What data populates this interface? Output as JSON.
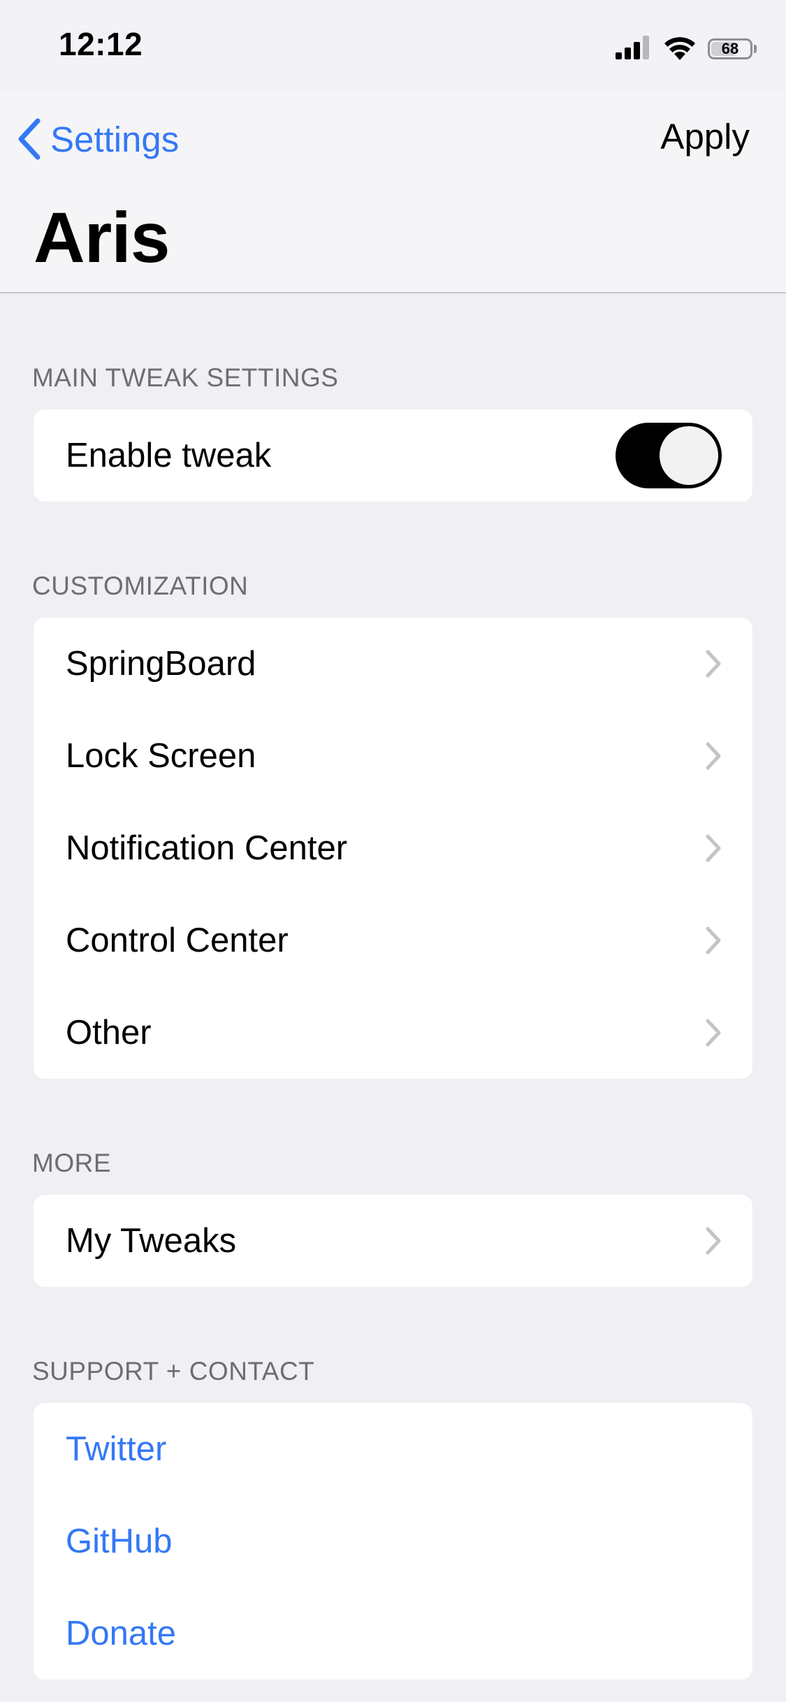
{
  "status_bar": {
    "time": "12:12",
    "battery": "68",
    "icons": [
      "cellular-signal-icon",
      "wifi-icon",
      "battery-icon"
    ]
  },
  "nav": {
    "back_label": "Settings",
    "back_icon": "chevron-left-icon",
    "apply_label": "Apply",
    "title": "Aris"
  },
  "sections": {
    "main": {
      "header": "MAIN TWEAK SETTINGS",
      "enable_label": "Enable tweak",
      "enable_on": true
    },
    "customization": {
      "header": "CUSTOMIZATION",
      "items": [
        {
          "label": "SpringBoard"
        },
        {
          "label": "Lock Screen"
        },
        {
          "label": "Notification Center"
        },
        {
          "label": "Control Center"
        },
        {
          "label": "Other"
        }
      ]
    },
    "more": {
      "header": "MORE",
      "items": [
        {
          "label": "My Tweaks"
        }
      ]
    },
    "support": {
      "header": "SUPPORT + CONTACT",
      "items": [
        {
          "label": "Twitter"
        },
        {
          "label": "GitHub"
        },
        {
          "label": "Donate"
        }
      ]
    }
  },
  "colors": {
    "accent": "#3478f6",
    "background": "#efeff4",
    "section_header": "#6d6d72",
    "chevron": "#c4c4c7",
    "toggle_on": "#000000"
  }
}
